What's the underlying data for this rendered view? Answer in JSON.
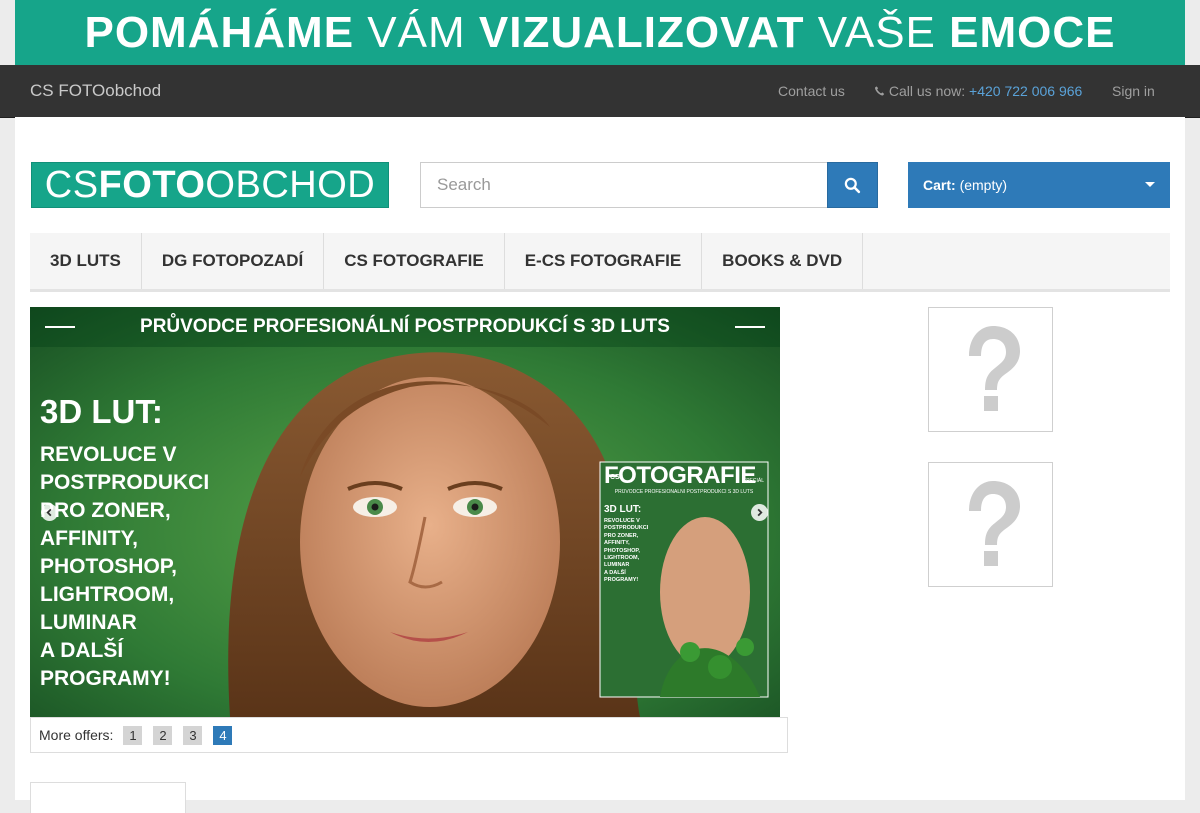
{
  "banner": {
    "part1": "POMÁHÁME",
    "part2": "VÁM",
    "part3": "VIZUALIZOVAT",
    "part4": "VAŠE",
    "part5": "EMOCE"
  },
  "topbar": {
    "brand": "CS FOTOobchod",
    "contact_label": "Contact us",
    "call_label": "Call us now:",
    "phone": "+420 722 006 966",
    "signin_label": "Sign in"
  },
  "header": {
    "logo_part1": "CS ",
    "logo_part2": "FOTO",
    "logo_part3": "OBCHOD",
    "search_placeholder": "Search",
    "cart_label": "Cart:",
    "cart_status": "(empty)"
  },
  "menu": {
    "items": [
      {
        "label": "3D LUTS"
      },
      {
        "label": "DG FOTOPOZADÍ"
      },
      {
        "label": "CS FOTOGRAFIE"
      },
      {
        "label": "E-CS FOTOGRAFIE"
      },
      {
        "label": "BOOKS & DVD"
      }
    ]
  },
  "slider": {
    "headline": "PRŮVODCE PROFESIONÁLNÍ POSTPRODUKCÍ S 3D LUTS",
    "title": "3D LUT:",
    "lines": [
      "REVOLUCE V",
      "POSTPRODUKCI",
      "PRO ZONER,",
      "AFFINITY,",
      "PHOTOSHOP,",
      "LIGHTROOM,",
      "LUMINAR",
      "A DALŠÍ",
      "PROGRAMY!"
    ],
    "cover_title": "FOTOGRAFIE",
    "cover_cs": "CS",
    "cover_special": "SPECIÁL",
    "cover_subtitle": "PRŮVODCE PROFESIONÁLNÍ POSTPRODUKCÍ S 3D LUTS",
    "cover_lut": "3D LUT:",
    "cover_lines": [
      "REVOLUCE V",
      "POSTPRODUKCI",
      "PRO ZONER,",
      "AFFINITY,",
      "PHOTOSHOP,",
      "LIGHTROOM,",
      "LUMINAR",
      "A DALŠÍ",
      "PROGRAMY!"
    ]
  },
  "offers": {
    "label": "More offers:",
    "pages": [
      "1",
      "2",
      "3",
      "4"
    ],
    "active_page": "4"
  },
  "colors": {
    "brand_green": "#16a58a",
    "accent_blue": "#2e7ab8",
    "topbar": "#333333"
  },
  "icons": {
    "search": "search-icon",
    "phone": "phone-icon",
    "prev": "chevron-left-icon",
    "next": "chevron-right-icon",
    "caret": "caret-down-icon",
    "placeholder": "question-mark-icon"
  }
}
